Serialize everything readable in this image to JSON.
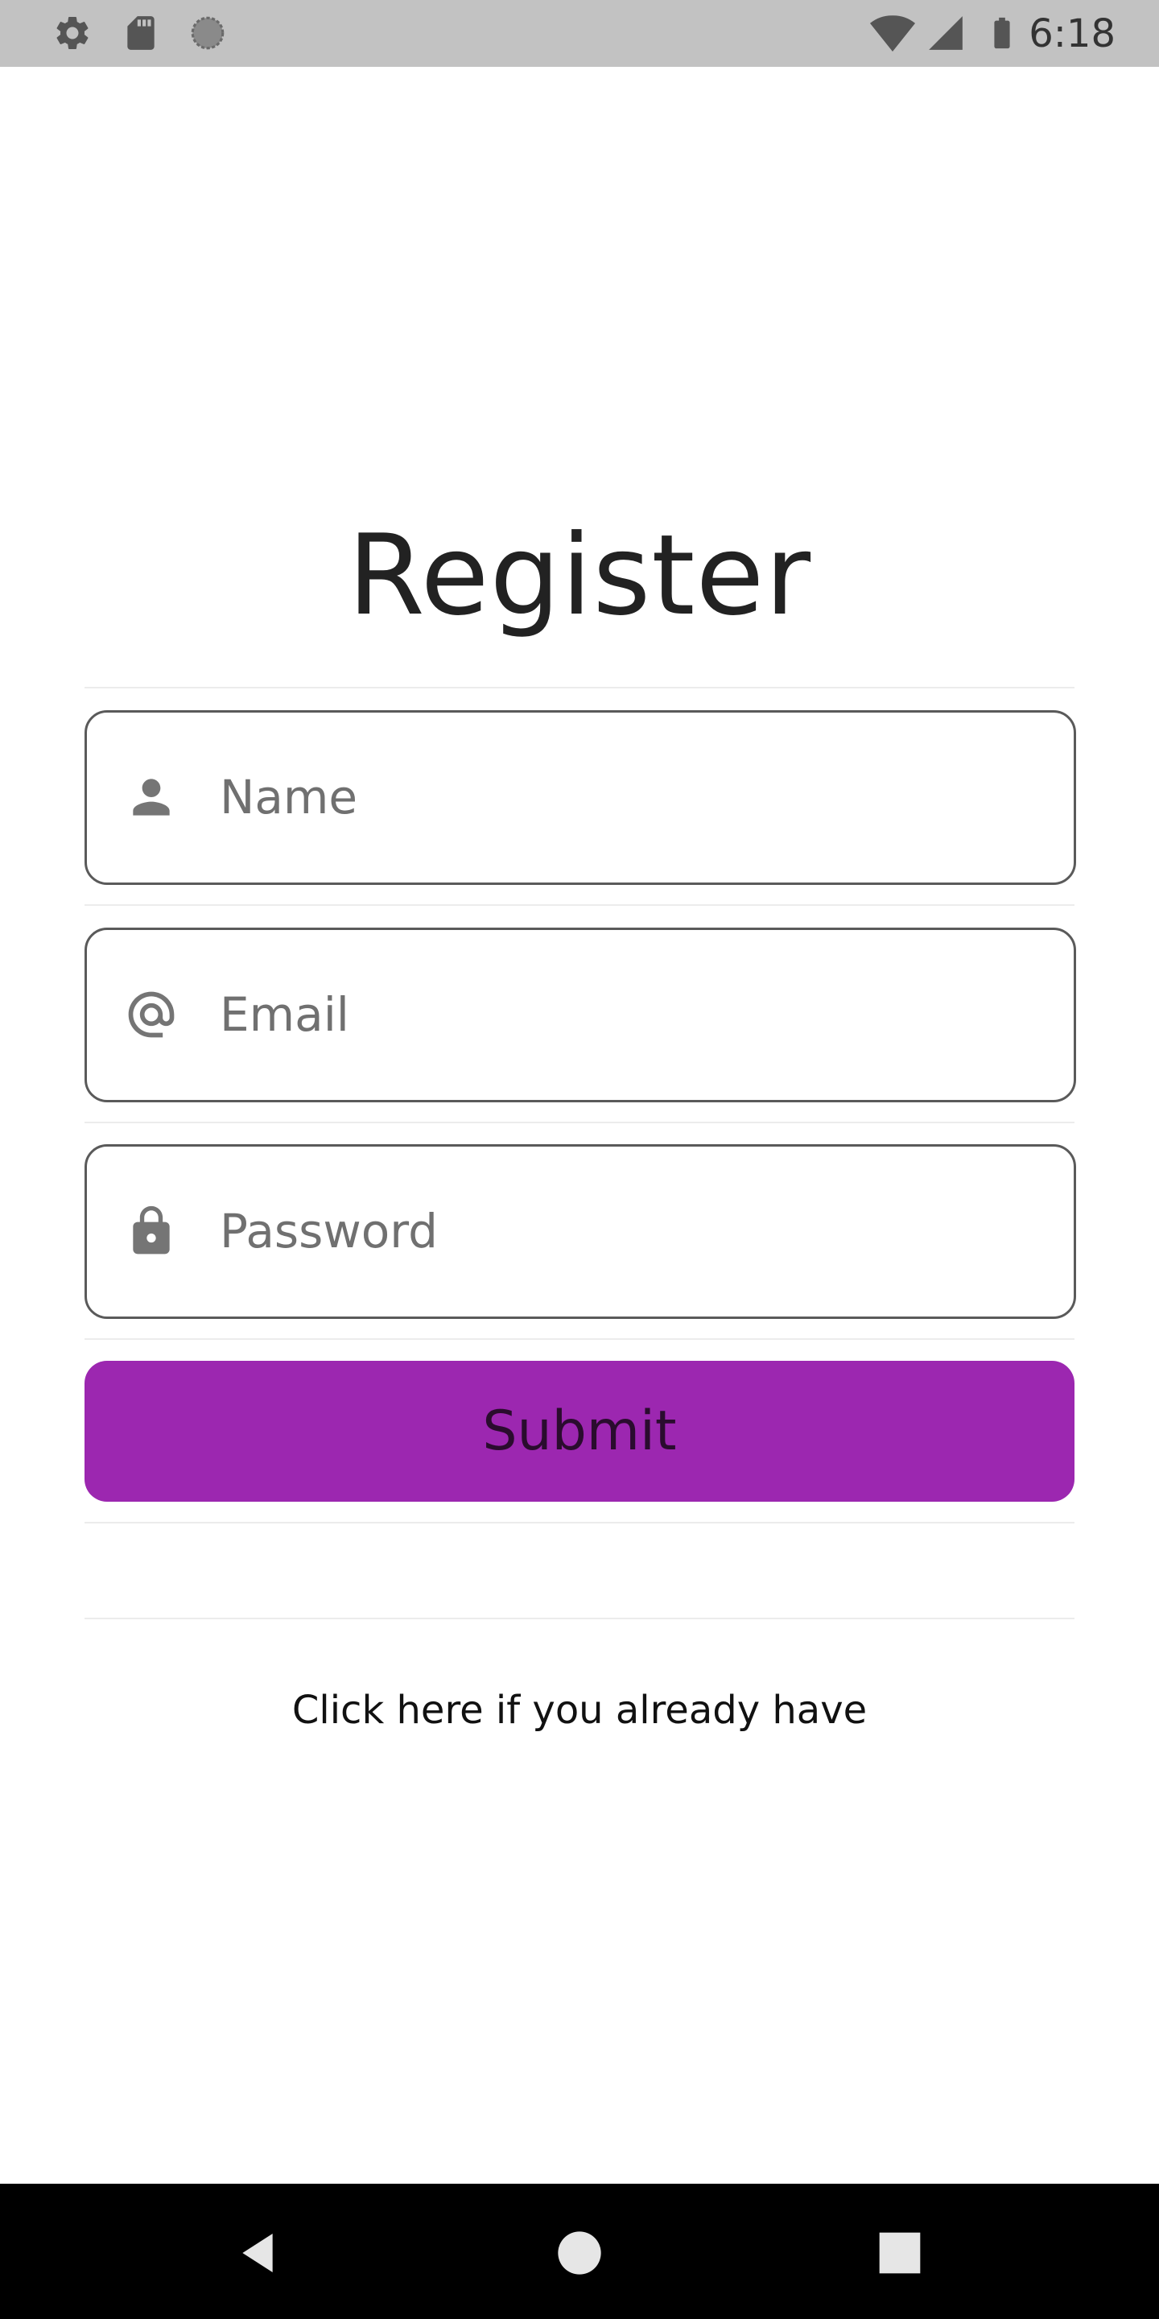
{
  "status_bar": {
    "time": "6:18",
    "left_icons": [
      "gear-icon",
      "sd-card-icon",
      "loading-circle-icon"
    ],
    "right_icons": [
      "wifi-icon",
      "cellular-signal-icon",
      "battery-icon"
    ],
    "background": "#c2c2c2"
  },
  "page": {
    "title": "Register"
  },
  "form": {
    "name": {
      "placeholder": "Name",
      "value": "",
      "icon": "person-icon"
    },
    "email": {
      "placeholder": "Email",
      "value": "",
      "icon": "at-sign-icon"
    },
    "password": {
      "placeholder": "Password",
      "value": "",
      "icon": "lock-icon"
    },
    "submit_label": "Submit",
    "submit_color": "#9c27b0"
  },
  "login_link": {
    "text": "Click here if you already have"
  },
  "nav_bar": {
    "buttons": [
      "back-icon",
      "home-icon",
      "recents-icon"
    ]
  }
}
